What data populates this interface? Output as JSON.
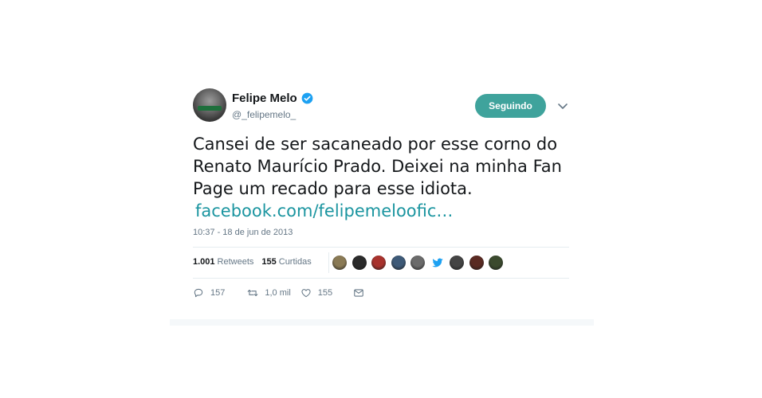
{
  "user": {
    "name": "Felipe Melo",
    "handle": "@_felipemelo_",
    "follow_label": "Seguindo",
    "verified_icon": "verified-badge-icon"
  },
  "tweet": {
    "lines": [
      "Cansei de ser sacaneado por esse corno do",
      "Renato Maurício Prado. Deixei na minha Fan",
      "Page um recado para esse idiota."
    ],
    "link": "facebook.com/felipemeloofic…",
    "timestamp": "10:37 - 18 de jun de 2013"
  },
  "stats": {
    "retweets_count": "1.001",
    "retweets_label": "Retweets",
    "likes_count": "155",
    "likes_label": "Curtidas"
  },
  "likers": [
    {
      "icon": "avatar",
      "color": "#8a7a55"
    },
    {
      "icon": "avatar",
      "color": "#2b2b2b"
    },
    {
      "icon": "avatar",
      "color": "#a8322d"
    },
    {
      "icon": "avatar",
      "color": "#3e5a78"
    },
    {
      "icon": "avatar",
      "color": "#6b6b6b"
    },
    {
      "icon": "bird-icon",
      "color": "#1da1f2"
    },
    {
      "icon": "avatar",
      "color": "#444444"
    },
    {
      "icon": "avatar",
      "color": "#5a2a22"
    },
    {
      "icon": "avatar",
      "color": "#3b4a2e"
    }
  ],
  "actions": {
    "replies": "157",
    "retweets": "1,0 mil",
    "likes": "155"
  },
  "colors": {
    "accent": "#3fa39c",
    "link": "#1b95a0",
    "muted": "#657786",
    "verified": "#1da1f2"
  }
}
